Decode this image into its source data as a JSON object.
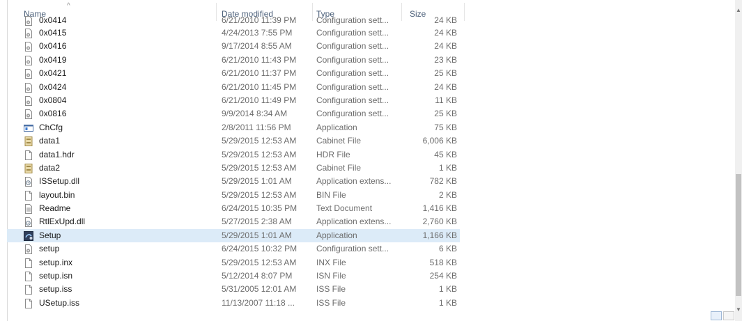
{
  "columns": {
    "name": "Name",
    "date": "Date modified",
    "type": "Type",
    "size": "Size"
  },
  "sort_indicator": "^",
  "files": [
    {
      "name": "0x0414",
      "date": "6/21/2010 11:39 PM",
      "type": "Configuration sett...",
      "size": "24 KB",
      "icon": "settings-file-icon"
    },
    {
      "name": "0x0415",
      "date": "4/24/2013 7:55 PM",
      "type": "Configuration sett...",
      "size": "24 KB",
      "icon": "settings-file-icon"
    },
    {
      "name": "0x0416",
      "date": "9/17/2014 8:55 AM",
      "type": "Configuration sett...",
      "size": "24 KB",
      "icon": "settings-file-icon"
    },
    {
      "name": "0x0419",
      "date": "6/21/2010 11:43 PM",
      "type": "Configuration sett...",
      "size": "23 KB",
      "icon": "settings-file-icon"
    },
    {
      "name": "0x0421",
      "date": "6/21/2010 11:37 PM",
      "type": "Configuration sett...",
      "size": "25 KB",
      "icon": "settings-file-icon"
    },
    {
      "name": "0x0424",
      "date": "6/21/2010 11:45 PM",
      "type": "Configuration sett...",
      "size": "24 KB",
      "icon": "settings-file-icon"
    },
    {
      "name": "0x0804",
      "date": "6/21/2010 11:49 PM",
      "type": "Configuration sett...",
      "size": "11 KB",
      "icon": "settings-file-icon"
    },
    {
      "name": "0x0816",
      "date": "9/9/2014 8:34 AM",
      "type": "Configuration sett...",
      "size": "25 KB",
      "icon": "settings-file-icon"
    },
    {
      "name": "ChCfg",
      "date": "2/8/2011 11:56 PM",
      "type": "Application",
      "size": "75 KB",
      "icon": "application-window-icon"
    },
    {
      "name": "data1",
      "date": "5/29/2015 12:53 AM",
      "type": "Cabinet File",
      "size": "6,006 KB",
      "icon": "cabinet-file-icon"
    },
    {
      "name": "data1.hdr",
      "date": "5/29/2015 12:53 AM",
      "type": "HDR File",
      "size": "45 KB",
      "icon": "blank-file-icon"
    },
    {
      "name": "data2",
      "date": "5/29/2015 12:53 AM",
      "type": "Cabinet File",
      "size": "1 KB",
      "icon": "cabinet-file-icon"
    },
    {
      "name": "ISSetup.dll",
      "date": "5/29/2015 1:01 AM",
      "type": "Application extens...",
      "size": "782 KB",
      "icon": "dll-file-icon"
    },
    {
      "name": "layout.bin",
      "date": "5/29/2015 12:53 AM",
      "type": "BIN File",
      "size": "2 KB",
      "icon": "blank-file-icon"
    },
    {
      "name": "Readme",
      "date": "6/24/2015 10:35 PM",
      "type": "Text Document",
      "size": "1,416 KB",
      "icon": "text-file-icon"
    },
    {
      "name": "RtlExUpd.dll",
      "date": "5/27/2015 2:38 AM",
      "type": "Application extens...",
      "size": "2,760 KB",
      "icon": "dll-file-icon"
    },
    {
      "name": "Setup",
      "date": "5/29/2015 1:01 AM",
      "type": "Application",
      "size": "1,166 KB",
      "icon": "setup-app-icon",
      "selected": true
    },
    {
      "name": "setup",
      "date": "6/24/2015 10:32 PM",
      "type": "Configuration sett...",
      "size": "6 KB",
      "icon": "settings-file-icon"
    },
    {
      "name": "setup.inx",
      "date": "5/29/2015 12:53 AM",
      "type": "INX File",
      "size": "518 KB",
      "icon": "blank-file-icon"
    },
    {
      "name": "setup.isn",
      "date": "5/12/2014 8:07 PM",
      "type": "ISN File",
      "size": "254 KB",
      "icon": "blank-file-icon"
    },
    {
      "name": "setup.iss",
      "date": "5/31/2005 12:01 AM",
      "type": "ISS File",
      "size": "1 KB",
      "icon": "blank-file-icon"
    },
    {
      "name": "USetup.iss",
      "date": "11/13/2007 11:18 ...",
      "type": "ISS File",
      "size": "1 KB",
      "icon": "blank-file-icon"
    }
  ],
  "colors": {
    "selected_row": "#dcebf8",
    "header_text": "#4c607a",
    "secondary_text": "#6d6d6d"
  }
}
